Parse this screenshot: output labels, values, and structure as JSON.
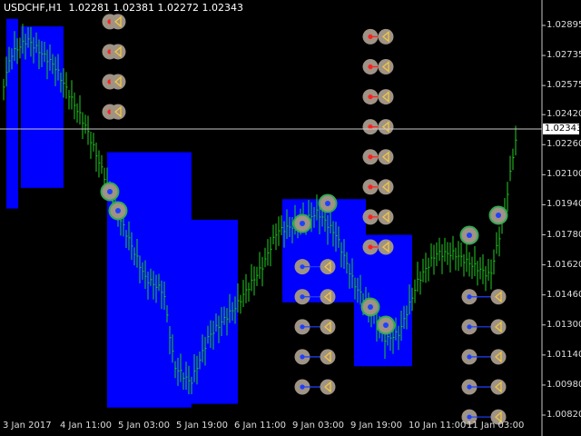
{
  "window": {
    "symbol_header": "USDCHF,H1  1.02281 1.02381 1.02272 1.02343"
  },
  "colors": {
    "background": "#000000",
    "bar_up": "#22cc22",
    "zone_fill": "#0000ff",
    "marker_disc": "#9e9385",
    "marker_arrow": "#f5c542",
    "marker_dot_red": "#ff2020",
    "marker_dot_blue": "#2040ff",
    "marker_ring": "#34a853",
    "axis_text": "#dddddd",
    "crosshair": "#c8c8c8"
  },
  "price_axis": {
    "labels": [
      "1.02895",
      "1.02735",
      "1.02575",
      "1.02420",
      "1.02260",
      "1.02100",
      "1.01940",
      "1.01780",
      "1.01620",
      "1.01460",
      "1.01300",
      "1.01140",
      "1.00980",
      "1.00820"
    ],
    "current_price": "1.02343"
  },
  "time_axis": {
    "labels": [
      "3 Jan 2017",
      "4 Jan 11:00",
      "5 Jan 03:00",
      "5 Jan 19:00",
      "6 Jan 11:00",
      "9 Jan 03:00",
      "9 Jan 19:00",
      "10 Jan 11:00",
      "11 Jan 03:00"
    ]
  },
  "chart_data": {
    "type": "ohlc",
    "symbol": "USDCHF",
    "timeframe": "H1",
    "last_bar": {
      "open": 1.02281,
      "high": 1.02381,
      "low": 1.02272,
      "close": 1.02343
    },
    "ylim": [
      1.008,
      1.0296
    ],
    "zones": [
      {
        "from": "3 Jan 2017",
        "to": "4 Jan 00:00",
        "high": 1.0293,
        "low": 1.0192
      },
      {
        "from": "4 Jan 03:00",
        "to": "4 Jan 11:00",
        "high": 1.0289,
        "low": 1.0203
      },
      {
        "from": "5 Jan 00:00",
        "to": "5 Jan 16:00",
        "high": 1.0222,
        "low": 1.0086
      },
      {
        "from": "5 Jan 19:00",
        "to": "6 Jan 11:00",
        "high": 1.0186,
        "low": 1.0088
      },
      {
        "from": "9 Jan 00:00",
        "to": "9 Jan 12:00",
        "high": 1.0197,
        "low": 1.0142
      },
      {
        "from": "9 Jan 19:00",
        "to": "10 Jan 11:00",
        "high": 1.0178,
        "low": 1.0108
      }
    ],
    "marker_columns": [
      {
        "time": "4 Jan 11:00",
        "dot": "red",
        "prices": [
          1.02915,
          1.02755,
          1.02595,
          1.02435
        ]
      },
      {
        "time": "9 Jan 03:00",
        "dot": "blue",
        "prices": [
          1.0161,
          1.0145,
          1.0129,
          1.0113,
          1.0097
        ]
      },
      {
        "time": "9 Jan 19:00",
        "dot": "red",
        "prices": [
          1.02835,
          1.02675,
          1.02515,
          1.02355,
          1.02195,
          1.02035,
          1.01875,
          1.01715
        ]
      },
      {
        "time": "11 Jan 03:00",
        "dot": "blue",
        "prices": [
          1.0145,
          1.0129,
          1.0113,
          1.0097,
          1.0081
        ]
      }
    ]
  }
}
